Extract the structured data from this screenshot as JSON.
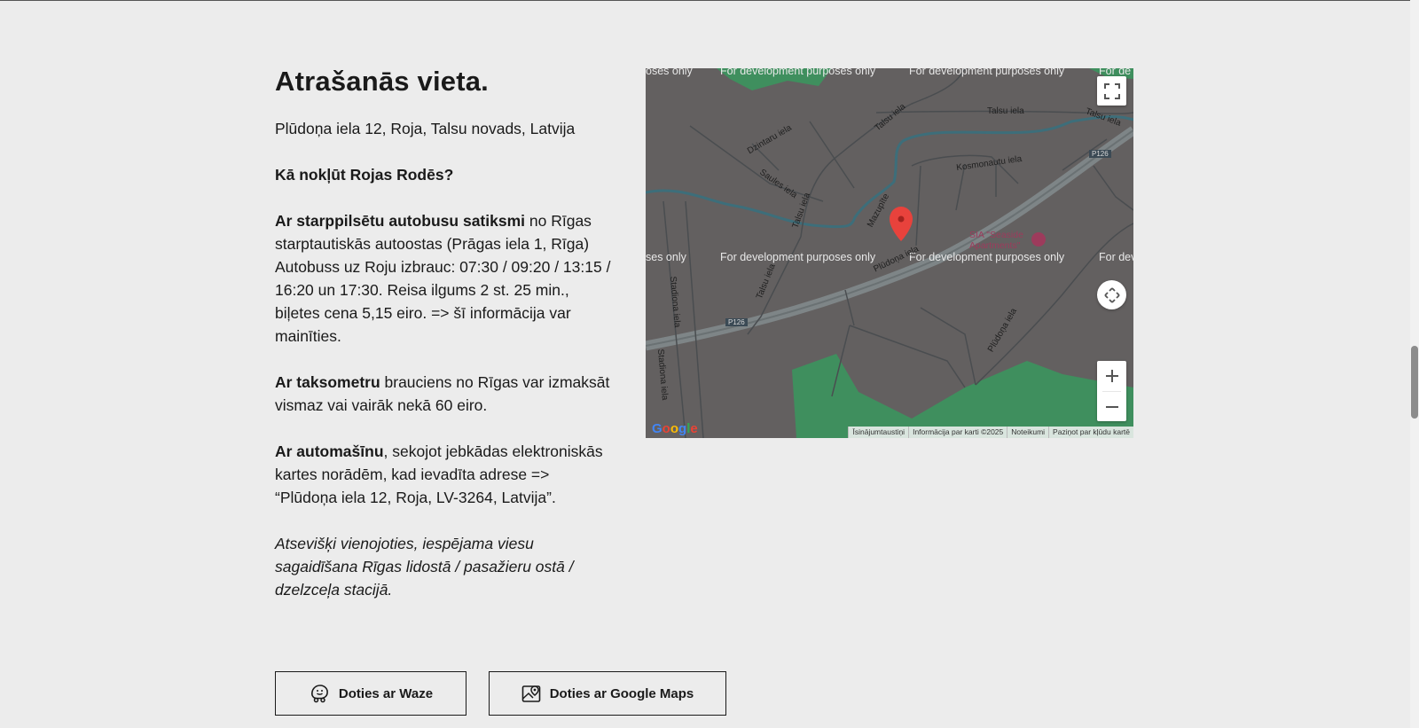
{
  "location": {
    "title": "Atrašanās vieta.",
    "address": "Plūdoņa iela 12, Roja, Talsu novads, Latvija",
    "question": "Kā nokļūt Rojas Rodēs?",
    "bus": {
      "bold": "Ar starppilsētu autobusu satiksmi",
      "text": " no Rīgas starptautiskās autoostas (Prāgas iela 1, Rīga) Autobuss uz Roju izbrauc: 07:30 / 09:20 / 13:15 / 16:20 un 17:30. Reisa ilgums 2 st. 25 min., biļetes cena 5,15 eiro. => šī informācija var mainīties."
    },
    "taxi": {
      "bold": "Ar taksometru",
      "text": " brauciens no Rīgas var izmaksāt vismaz vai vairāk nekā 60 eiro."
    },
    "car": {
      "bold": "Ar automašīnu",
      "text": ", sekojot jebkādas elektroniskās kartes norādēm, kad ievadīta adrese => “Plūdoņa iela 12, Roja, LV-3264, Latvija”."
    },
    "note": "Atsevišķi vienojoties, iespējama viesu sagaidīšana Rīgas lidostā / pasažieru ostā / dzelzceļa stacijā."
  },
  "map": {
    "dev_watermark": "For development purposes only",
    "dev_watermark_short_left": "ses only",
    "dev_watermark_short_right": "For dev",
    "dev_watermark_top_left": "oses only",
    "dev_watermark_top_right": "For de",
    "streets": {
      "talsu_iela": "Talsu iela",
      "dzintaru_iela": "Dzintaru iela",
      "saules_iela": "Saules iela",
      "mazupite": "Mazupīte",
      "kosmonautu_iela": "Kosmonautu iela",
      "pludona_iela": "Plūdoņa iela",
      "stadiona_iela": "Stadiona iela",
      "p126": "P126"
    },
    "poi": "SIA \"Seaside Apartments\"",
    "google_logo": "Google",
    "attribution": [
      "Īsinājumtaustiņi",
      "Informācija par karti ©2025",
      "Noteikumi",
      "Paziņot par kļūdu kartē"
    ],
    "colors": {
      "land": "#636060",
      "green": "#3f8f5e",
      "water": "#3d6e7a",
      "pin": "#e8423c"
    }
  },
  "buttons": {
    "waze": "Doties ar Waze",
    "google_maps": "Doties ar Google Maps"
  }
}
